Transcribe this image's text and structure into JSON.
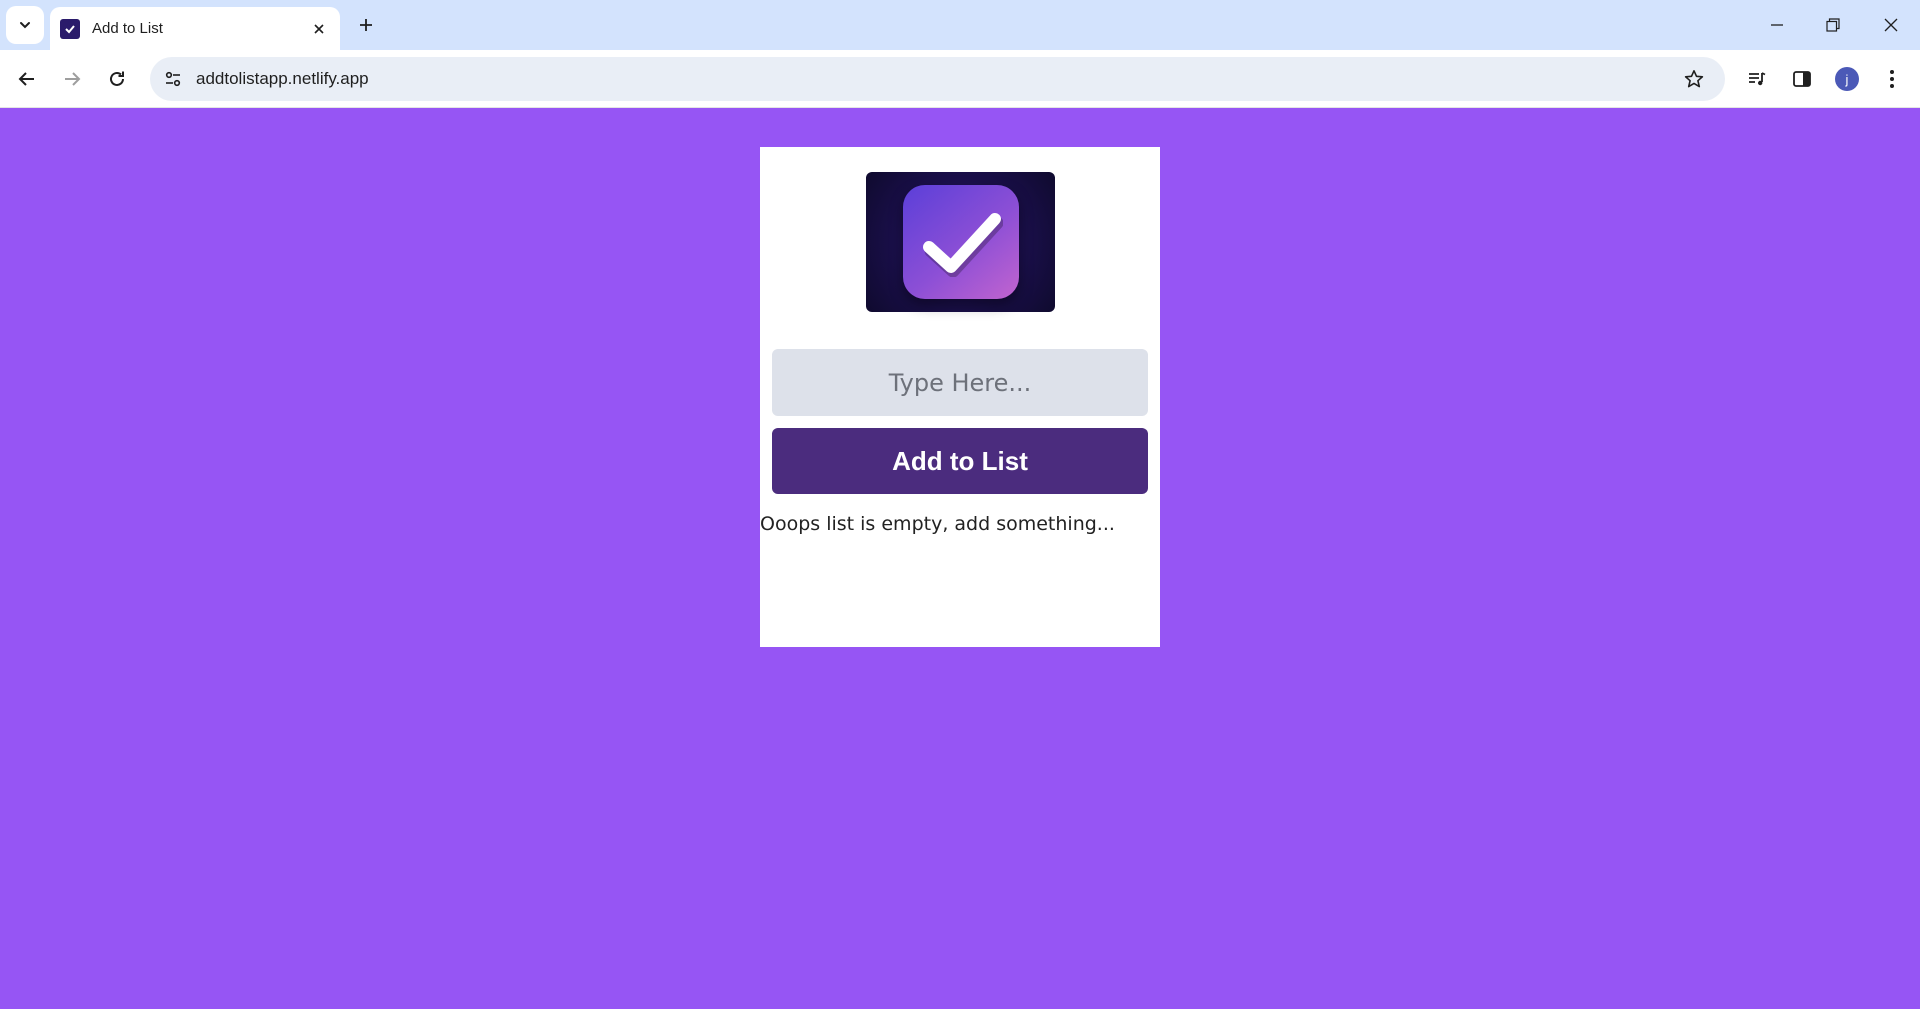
{
  "browser": {
    "tab": {
      "title": "Add to List"
    },
    "address_bar": {
      "url": "addtolistapp.netlify.app"
    },
    "profile": {
      "initial": "j"
    }
  },
  "page": {
    "background_color": "#9655f4",
    "input": {
      "placeholder": "Type Here...",
      "value": ""
    },
    "add_button": {
      "label": "Add to List",
      "color": "#4b2c7e"
    },
    "empty_message": "Ooops list is empty, add something..."
  }
}
